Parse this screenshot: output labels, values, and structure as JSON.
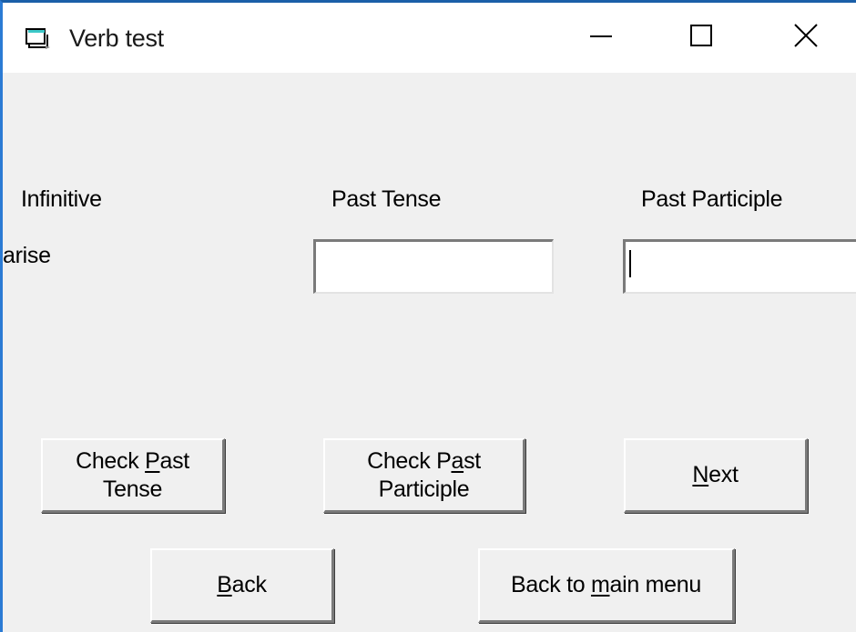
{
  "window": {
    "title": "Verb test",
    "icon": "form-window-icon",
    "controls": {
      "minimize": "minimize-icon",
      "maximize": "maximize-icon",
      "close": "close-icon"
    }
  },
  "form": {
    "headers": {
      "infinitive": "Infinitive",
      "past_tense": "Past Tense",
      "past_participle": "Past Participle"
    },
    "current_verb": "arise",
    "inputs": {
      "past_tense": {
        "value": "",
        "placeholder": ""
      },
      "past_participle": {
        "value": "",
        "placeholder": ""
      }
    }
  },
  "buttons": {
    "check_past_tense": {
      "pre": "Check ",
      "accel": "P",
      "post": "ast",
      "line2": "Tense"
    },
    "check_past_participle": {
      "pre": "Check P",
      "accel": "a",
      "post": "st",
      "line2": "Participle"
    },
    "next": {
      "pre": "",
      "accel": "N",
      "post": "ext"
    },
    "back": {
      "pre": "",
      "accel": "B",
      "post": "ack"
    },
    "back_to_main_menu": {
      "pre": "Back to ",
      "accel": "m",
      "post": "ain menu"
    }
  },
  "colors": {
    "window_border": "#2b7bd4",
    "client_background": "#f0f0f0",
    "titlebar_background": "#ffffff"
  }
}
